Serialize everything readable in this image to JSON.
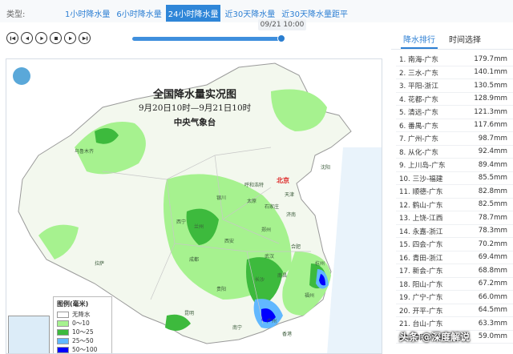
{
  "type_selector": {
    "label": "类型:",
    "tabs": [
      "1小时降水量",
      "6小时降水量",
      "24小时降水量",
      "近30天降水量",
      "近30天降水量距平"
    ],
    "active_index": 2
  },
  "player": {
    "time_tooltip": "09/21 10:00",
    "buttons": [
      "first",
      "previous",
      "play",
      "stop",
      "next",
      "last"
    ],
    "progress": 1.0
  },
  "map": {
    "title": "全国降水量实况图",
    "subtitle": "9月20日10时—9月21日10时",
    "source": "中央气象台",
    "capital_label": "北京",
    "cities": [
      {
        "id": "wulumuqi",
        "name": "乌鲁木齐"
      },
      {
        "id": "huhehaote",
        "name": "呼和浩特"
      },
      {
        "id": "tianjin",
        "name": "天津"
      },
      {
        "id": "shenyang",
        "name": "沈阳"
      },
      {
        "id": "yinchuan",
        "name": "银川"
      },
      {
        "id": "taiyuan",
        "name": "太原"
      },
      {
        "id": "shijiazhuang",
        "name": "石家庄"
      },
      {
        "id": "jinan",
        "name": "济南"
      },
      {
        "id": "xining",
        "name": "西宁"
      },
      {
        "id": "lanzhou",
        "name": "兰州"
      },
      {
        "id": "zhengzhou",
        "name": "郑州"
      },
      {
        "id": "xian",
        "name": "西安"
      },
      {
        "id": "hefei",
        "name": "合肥"
      },
      {
        "id": "chengdu",
        "name": "成都"
      },
      {
        "id": "wuhan",
        "name": "武汉"
      },
      {
        "id": "hangzhou",
        "name": "杭州"
      },
      {
        "id": "lasa",
        "name": "拉萨"
      },
      {
        "id": "changsha",
        "name": "长沙"
      },
      {
        "id": "nanchang",
        "name": "南昌"
      },
      {
        "id": "guiyang",
        "name": "贵阳"
      },
      {
        "id": "fuzhou",
        "name": "福州"
      },
      {
        "id": "kunming",
        "name": "昆明"
      },
      {
        "id": "nanning",
        "name": "南宁"
      },
      {
        "id": "guangzhou",
        "name": "广州"
      },
      {
        "id": "xianggang",
        "name": "香港"
      }
    ],
    "legend": {
      "title": "图例(毫米)",
      "items": [
        {
          "label": "无降水",
          "color": "#ffffff"
        },
        {
          "label": "0～10",
          "color": "#a6f28f"
        },
        {
          "label": "10～25",
          "color": "#3dba3d"
        },
        {
          "label": "25～50",
          "color": "#61b8ff"
        },
        {
          "label": "50～100",
          "color": "#0000fe"
        }
      ]
    }
  },
  "ranking": {
    "tabs": [
      "降水排行",
      "时间选择"
    ],
    "active_tab": 0,
    "rows": [
      {
        "name": "1. 南海-广东",
        "value": "179.7mm"
      },
      {
        "name": "2. 三水-广东",
        "value": "140.1mm"
      },
      {
        "name": "3. 平阳-浙江",
        "value": "130.5mm"
      },
      {
        "name": "4. 花都-广东",
        "value": "128.9mm"
      },
      {
        "name": "5. 清远-广东",
        "value": "121.3mm"
      },
      {
        "name": "6. 番禺-广东",
        "value": "117.6mm"
      },
      {
        "name": "7. 广州-广东",
        "value": "98.7mm"
      },
      {
        "name": "8. 从化-广东",
        "value": "92.4mm"
      },
      {
        "name": "9. 上川岛-广东",
        "value": "89.4mm"
      },
      {
        "name": "10. 三沙-福建",
        "value": "85.5mm"
      },
      {
        "name": "11. 顺德-广东",
        "value": "82.8mm"
      },
      {
        "name": "12. 鹤山-广东",
        "value": "82.5mm"
      },
      {
        "name": "13. 上饶-江西",
        "value": "78.7mm"
      },
      {
        "name": "14. 永嘉-浙江",
        "value": "78.3mm"
      },
      {
        "name": "15. 四会-广东",
        "value": "70.2mm"
      },
      {
        "name": "16. 青田-浙江",
        "value": "69.4mm"
      },
      {
        "name": "17. 新会-广东",
        "value": "68.8mm"
      },
      {
        "name": "18. 阳山-广东",
        "value": "67.2mm"
      },
      {
        "name": "19. 广宁-广东",
        "value": "66.0mm"
      },
      {
        "name": "20. 开平-广东",
        "value": "64.5mm"
      },
      {
        "name": "21. 台山-广东",
        "value": "63.3mm"
      },
      {
        "name": "22. 佛冈-广东",
        "value": "59.0mm"
      }
    ]
  },
  "watermark": "头条 @深度解说"
}
